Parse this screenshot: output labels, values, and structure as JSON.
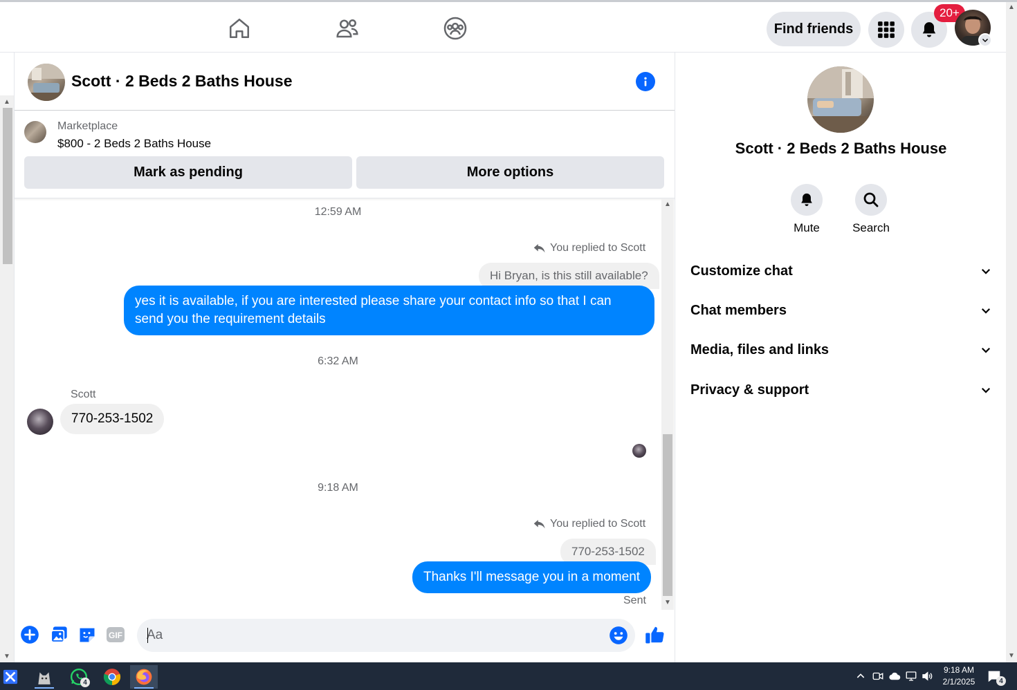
{
  "topnav": {
    "find_friends": "Find friends",
    "notifications_badge": "20+"
  },
  "chat": {
    "title": "Scott · 2 Beds 2 Baths House",
    "marketplace_label": "Marketplace",
    "listing": "$800 - 2 Beds 2 Baths House",
    "mark_pending": "Mark as pending",
    "more_options": "More options"
  },
  "messages": {
    "ts1": "12:59 AM",
    "replied1": "You replied to Scott",
    "quote1": "Hi Bryan, is this still available?",
    "out1": "yes it is available, if you are interested please share your contact info so that I can send you the requirement details",
    "ts2": "6:32 AM",
    "sender": "Scott",
    "in1": "770-253-1502",
    "ts3": "9:18 AM",
    "replied2": "You replied to Scott",
    "quote2": "770-253-1502",
    "out2": "Thanks I'll message you in a moment",
    "status": "Sent"
  },
  "composer": {
    "placeholder": "Aa",
    "gif_label": "GIF"
  },
  "panel": {
    "name": "Scott · 2 Beds 2 Baths House",
    "mute": "Mute",
    "search": "Search",
    "sections": [
      "Customize chat",
      "Chat members",
      "Media, files and links",
      "Privacy & support"
    ]
  },
  "taskbar": {
    "whatsapp_badge": "4",
    "time": "9:18 AM",
    "date": "2/1/2025",
    "notif_count": "4"
  },
  "colors": {
    "accent": "#0866ff",
    "bubble_out": "#0084ff",
    "badge": "#e41e3f"
  }
}
